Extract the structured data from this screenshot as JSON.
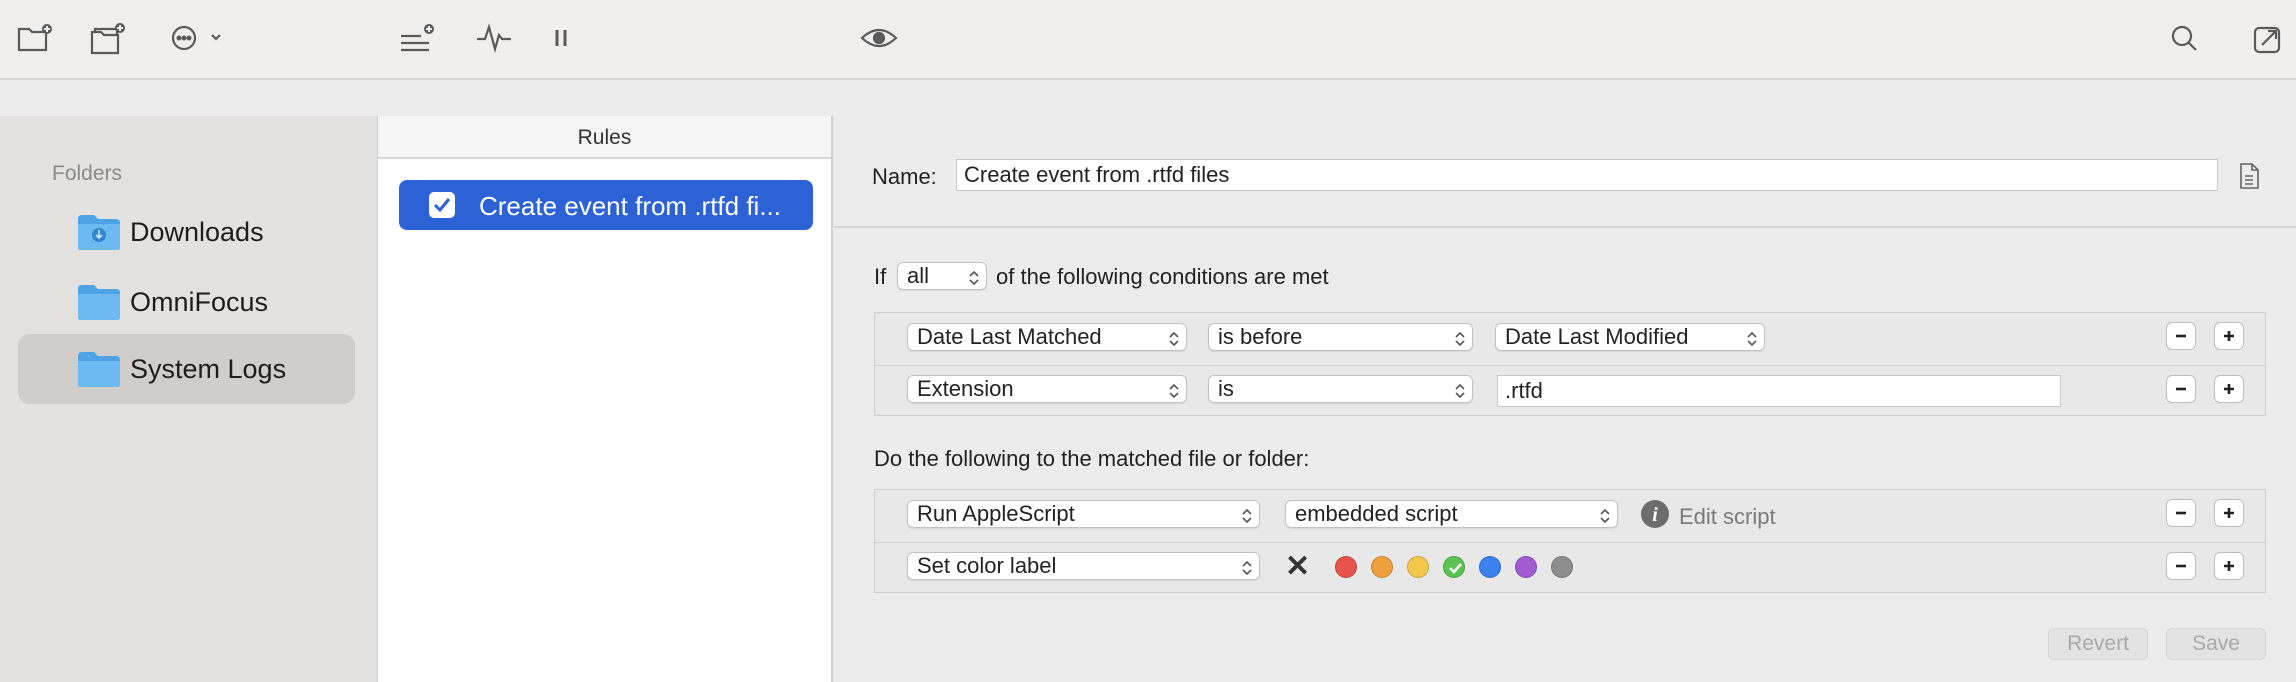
{
  "toolbar": {
    "new_folder_icon": "folder-add-icon",
    "new_folder_group_icon": "folder-stack-add-icon",
    "more_icon": "ellipsis-circle-icon",
    "add_rule_icon": "list-add-icon",
    "activity_icon": "waveform-icon",
    "pause_icon": "pause-icon",
    "preview_icon": "eye-icon",
    "search_icon": "search-icon",
    "share_icon": "share-icon"
  },
  "sidebar": {
    "heading": "Folders",
    "items": [
      {
        "label": "Downloads",
        "icon": "download-folder-icon",
        "selected": false
      },
      {
        "label": "OmniFocus",
        "icon": "folder-icon",
        "selected": false
      },
      {
        "label": "System Logs",
        "icon": "folder-icon",
        "selected": true
      }
    ]
  },
  "rules": {
    "header": "Rules",
    "items": [
      {
        "label": "Create event from .rtfd fi...",
        "enabled": true
      }
    ]
  },
  "editor": {
    "name_label": "Name:",
    "name_value": "Create event from .rtfd files",
    "if_label": "If",
    "match_select": "all",
    "conditions_suffix": "of the following conditions are met",
    "conditions": [
      {
        "attribute": "Date Last Matched",
        "operator": "is before",
        "value_select": "Date Last Modified"
      },
      {
        "attribute": "Extension",
        "operator": "is",
        "value_text": ".rtfd"
      }
    ],
    "actions_heading": "Do the following to the matched file or folder:",
    "actions": [
      {
        "action": "Run AppleScript",
        "script_source": "embedded script",
        "edit_label": "Edit script"
      },
      {
        "action": "Set color label"
      }
    ],
    "color_labels": {
      "none_symbol": "✕",
      "colors": [
        "#e5534b",
        "#eea03e",
        "#f2c94c",
        "#5ac351",
        "#3b82f0",
        "#a25ad1",
        "#8e8e8e"
      ],
      "selected_index": 3
    },
    "revert_label": "Revert",
    "save_label": "Save"
  }
}
